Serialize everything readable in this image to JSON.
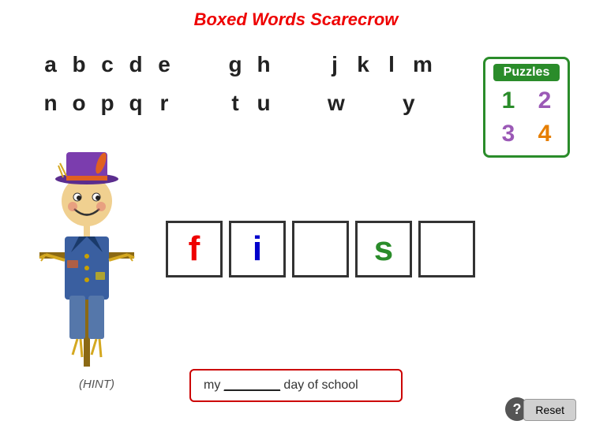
{
  "header": {
    "title": "Boxed Words Scarecrow"
  },
  "alphabet": {
    "row1": [
      "a",
      "b",
      "c",
      "d",
      "e",
      "",
      "g",
      "h",
      "",
      "j",
      "k",
      "l",
      "m"
    ],
    "row2": [
      "n",
      "o",
      "p",
      "q",
      "r",
      "",
      "t",
      "u",
      "",
      "w",
      "",
      "y",
      ""
    ]
  },
  "puzzles": {
    "label": "Puzzles",
    "numbers": [
      {
        "value": "1",
        "color_class": "p1"
      },
      {
        "value": "2",
        "color_class": "p2"
      },
      {
        "value": "3",
        "color_class": "p3"
      },
      {
        "value": "4",
        "color_class": "p4"
      }
    ]
  },
  "word_boxes": [
    {
      "letter": "f",
      "color": "wb-red"
    },
    {
      "letter": "i",
      "color": "wb-blue"
    },
    {
      "letter": "",
      "color": "wb-empty"
    },
    {
      "letter": "s",
      "color": "wb-green"
    },
    {
      "letter": "",
      "color": "wb-empty"
    }
  ],
  "hint": {
    "label": "(HINT)"
  },
  "sentence": {
    "text": "my",
    "blank": "________",
    "rest": "day of school"
  },
  "buttons": {
    "help": "?",
    "reset": "Reset"
  }
}
